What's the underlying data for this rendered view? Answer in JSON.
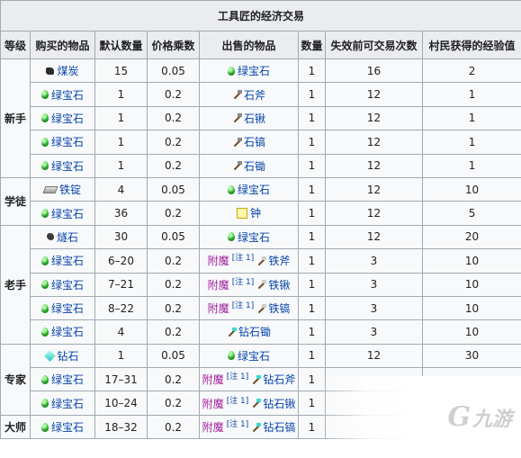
{
  "table": {
    "caption": "工具匠的经济交易",
    "headers": [
      "等级",
      "购买的物品",
      "默认数量",
      "价格乘数",
      "出售的物品",
      "数量",
      "失效前可交易次数",
      "村民获得的经验值"
    ],
    "note_mark": "[注 1]",
    "enchant_prefix": "附魔",
    "tiers": [
      {
        "name": "新手",
        "rowspan": 5
      },
      {
        "name": "学徒",
        "rowspan": 2
      },
      {
        "name": "老手",
        "rowspan": 5
      },
      {
        "name": "专家",
        "rowspan": 3
      },
      {
        "name": "大师",
        "rowspan": 1
      }
    ],
    "rows": [
      {
        "buy": "煤炭",
        "buy_icon": "coal-icon",
        "qty": "15",
        "mult": "0.05",
        "sell": "绿宝石",
        "sell_icon": "emerald-icon",
        "sell_enchanted": false,
        "sell_qty": "1",
        "uses": "16",
        "xp": "2"
      },
      {
        "buy": "绿宝石",
        "buy_icon": "emerald-icon",
        "qty": "1",
        "mult": "0.2",
        "sell": "石斧",
        "sell_icon": "stone-axe-icon",
        "sell_enchanted": false,
        "sell_qty": "1",
        "uses": "12",
        "xp": "1"
      },
      {
        "buy": "绿宝石",
        "buy_icon": "emerald-icon",
        "qty": "1",
        "mult": "0.2",
        "sell": "石锹",
        "sell_icon": "stone-shovel-icon",
        "sell_enchanted": false,
        "sell_qty": "1",
        "uses": "12",
        "xp": "1"
      },
      {
        "buy": "绿宝石",
        "buy_icon": "emerald-icon",
        "qty": "1",
        "mult": "0.2",
        "sell": "石镐",
        "sell_icon": "stone-pickaxe-icon",
        "sell_enchanted": false,
        "sell_qty": "1",
        "uses": "12",
        "xp": "1"
      },
      {
        "buy": "绿宝石",
        "buy_icon": "emerald-icon",
        "qty": "1",
        "mult": "0.2",
        "sell": "石锄",
        "sell_icon": "stone-hoe-icon",
        "sell_enchanted": false,
        "sell_qty": "1",
        "uses": "12",
        "xp": "1"
      },
      {
        "buy": "铁锭",
        "buy_icon": "iron-ingot-icon",
        "qty": "4",
        "mult": "0.05",
        "sell": "绿宝石",
        "sell_icon": "emerald-icon",
        "sell_enchanted": false,
        "sell_qty": "1",
        "uses": "12",
        "xp": "10"
      },
      {
        "buy": "绿宝石",
        "buy_icon": "emerald-icon",
        "qty": "36",
        "mult": "0.2",
        "sell": "钟",
        "sell_icon": "bell-icon",
        "sell_enchanted": false,
        "sell_qty": "1",
        "uses": "12",
        "xp": "5"
      },
      {
        "buy": "燧石",
        "buy_icon": "flint-icon",
        "qty": "30",
        "mult": "0.05",
        "sell": "绿宝石",
        "sell_icon": "emerald-icon",
        "sell_enchanted": false,
        "sell_qty": "1",
        "uses": "12",
        "xp": "20"
      },
      {
        "buy": "绿宝石",
        "buy_icon": "emerald-icon",
        "qty": "6–20",
        "mult": "0.2",
        "sell": "铁斧",
        "sell_icon": "iron-axe-icon",
        "sell_enchanted": true,
        "sell_qty": "1",
        "uses": "3",
        "xp": "10"
      },
      {
        "buy": "绿宝石",
        "buy_icon": "emerald-icon",
        "qty": "7–21",
        "mult": "0.2",
        "sell": "铁锹",
        "sell_icon": "iron-shovel-icon",
        "sell_enchanted": true,
        "sell_qty": "1",
        "uses": "3",
        "xp": "10"
      },
      {
        "buy": "绿宝石",
        "buy_icon": "emerald-icon",
        "qty": "8–22",
        "mult": "0.2",
        "sell": "铁镐",
        "sell_icon": "iron-pickaxe-icon",
        "sell_enchanted": true,
        "sell_qty": "1",
        "uses": "3",
        "xp": "10"
      },
      {
        "buy": "绿宝石",
        "buy_icon": "emerald-icon",
        "qty": "4",
        "mult": "0.2",
        "sell": "钻石锄",
        "sell_icon": "diamond-hoe-icon",
        "sell_enchanted": false,
        "sell_qty": "1",
        "uses": "3",
        "xp": "10"
      },
      {
        "buy": "钻石",
        "buy_icon": "diamond-icon",
        "qty": "1",
        "mult": "0.05",
        "sell": "绿宝石",
        "sell_icon": "emerald-icon",
        "sell_enchanted": false,
        "sell_qty": "1",
        "uses": "12",
        "xp": "30"
      },
      {
        "buy": "绿宝石",
        "buy_icon": "emerald-icon",
        "qty": "17–31",
        "mult": "0.2",
        "sell": "钻石斧",
        "sell_icon": "diamond-axe-icon",
        "sell_enchanted": true,
        "sell_qty": "1",
        "uses": "",
        "xp": ""
      },
      {
        "buy": "绿宝石",
        "buy_icon": "emerald-icon",
        "qty": "10–24",
        "mult": "0.2",
        "sell": "钻石锹",
        "sell_icon": "diamond-shovel-icon",
        "sell_enchanted": true,
        "sell_qty": "1",
        "uses": "",
        "xp": ""
      },
      {
        "buy": "绿宝石",
        "buy_icon": "emerald-icon",
        "qty": "18–32",
        "mult": "0.2",
        "sell": "钻石镐",
        "sell_icon": "diamond-pickaxe-icon",
        "sell_enchanted": true,
        "sell_qty": "1",
        "uses": "",
        "xp": ""
      }
    ]
  },
  "watermark": {
    "brand": "九游"
  }
}
